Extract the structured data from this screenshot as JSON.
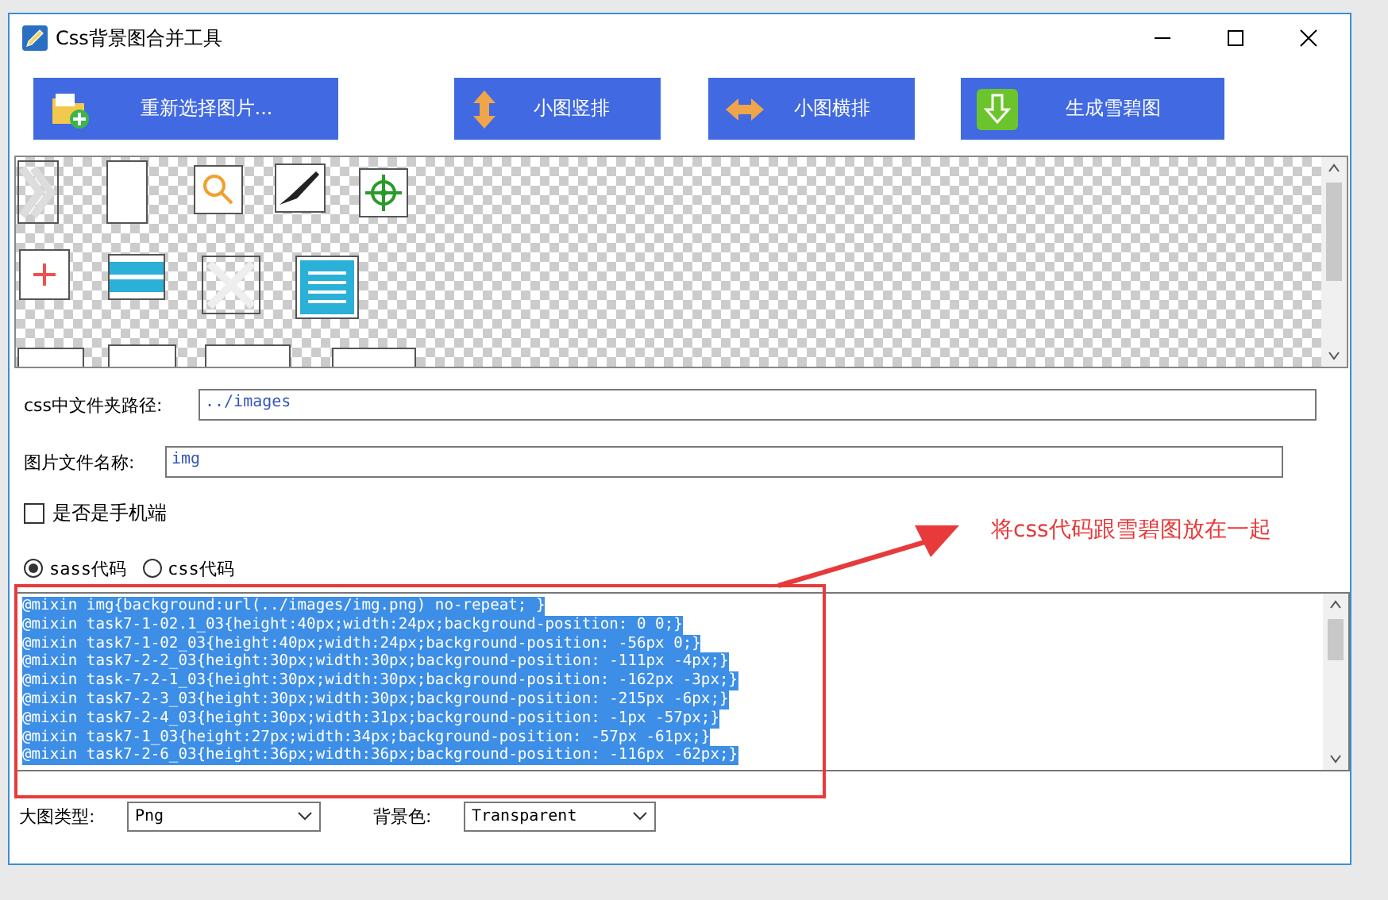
{
  "window": {
    "title": "Css背景图合并工具"
  },
  "toolbar": [
    {
      "label": "重新选择图片...",
      "kind": "folder"
    },
    {
      "label": "小图竖排",
      "kind": "vertical"
    },
    {
      "label": "小图横排",
      "kind": "horizontal"
    },
    {
      "label": "生成雪碧图",
      "kind": "download"
    }
  ],
  "css_path": {
    "label": "css中文件夹路径:",
    "value": "../images"
  },
  "image_name": {
    "label": "图片文件名称:",
    "value": "img"
  },
  "mobile": {
    "label": "是否是手机端",
    "checked": false
  },
  "code_type": [
    {
      "label": "sass代码",
      "selected": true
    },
    {
      "label": "css代码",
      "selected": false
    }
  ],
  "code_lines": [
    {
      "text": "@mixin img{background:url(../images/img.png) no-repeat; }",
      "selected": true
    },
    {
      "text": "@mixin task7-1-02.1_03{height:40px;width:24px;background-position: 0 0;}",
      "selected": true
    },
    {
      "text": "@mixin task7-1-02_03{height:40px;width:24px;background-position: -56px 0;}",
      "selected": true
    },
    {
      "text": "@mixin task7-2-2_03{height:30px;width:30px;background-position: -111px -4px;}",
      "selected": true
    },
    {
      "text": "@mixin task-7-2-1_03{height:30px;width:30px;background-position: -162px -3px;}",
      "selected": true
    },
    {
      "text": "@mixin task7-2-3_03{height:30px;width:30px;background-position: -215px -6px;}",
      "selected": true
    },
    {
      "text": "@mixin task7-2-4_03{height:30px;width:31px;background-position: -1px -57px;}",
      "selected": true
    },
    {
      "text": "@mixin task7-1_03{height:27px;width:34px;background-position: -57px -61px;}",
      "selected": true
    },
    {
      "text": "@mixin task7-2-6_03{height:36px;width:36px;background-position: -116px -62px;}",
      "selected": true
    }
  ],
  "image_type": {
    "label": "大图类型:",
    "value": "Png"
  },
  "background_color": {
    "label": "背景色:",
    "value": "Transparent"
  },
  "annotation": {
    "text": "将css代码跟雪碧图放在一起"
  }
}
